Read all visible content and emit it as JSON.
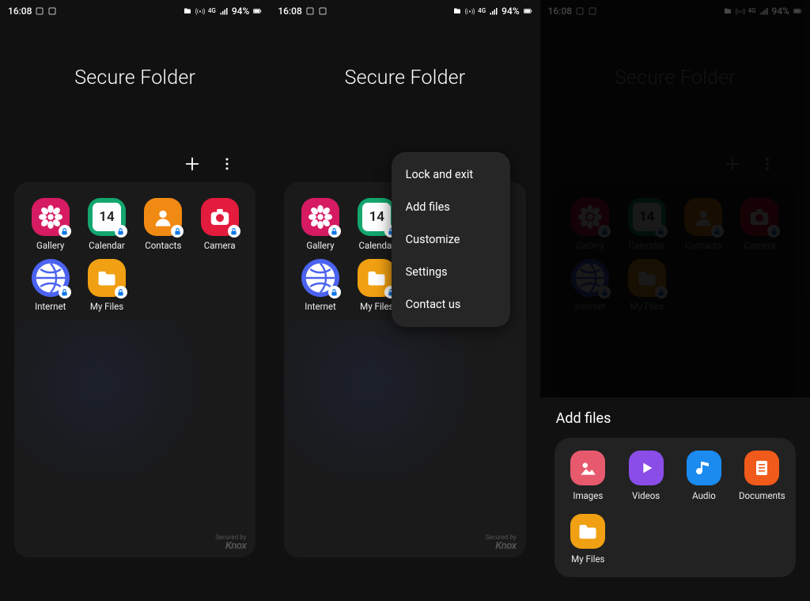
{
  "status": {
    "time": "16:08",
    "battery_pct": "94%",
    "network": "4G",
    "icons": [
      "screenshot-icon",
      "screenshot2-icon",
      "folder-icon",
      "hotspot-icon",
      "4g-icon",
      "signal-icon",
      "battery-icon"
    ]
  },
  "title": "Secure Folder",
  "apps": [
    {
      "name": "Gallery",
      "color": "#d61b63",
      "shape": "square",
      "glyph": "flower"
    },
    {
      "name": "Calendar",
      "color": "#13a66e",
      "shape": "square",
      "glyph": "cal14"
    },
    {
      "name": "Contacts",
      "color": "#f18a13",
      "shape": "square",
      "glyph": "person"
    },
    {
      "name": "Camera",
      "color": "#e31b3d",
      "shape": "square",
      "glyph": "camera"
    },
    {
      "name": "Internet",
      "color": "#4b63f0",
      "shape": "round",
      "glyph": "globe"
    },
    {
      "name": "My Files",
      "color": "#f0a012",
      "shape": "square",
      "glyph": "folder"
    }
  ],
  "calendar_day": "14",
  "knox": {
    "small": "Secured by",
    "big": "Knox"
  },
  "menu": {
    "items": [
      {
        "label": "Lock and exit"
      },
      {
        "label": "Add files"
      },
      {
        "label": "Customize"
      },
      {
        "label": "Settings"
      },
      {
        "label": "Contact us"
      }
    ]
  },
  "sheet": {
    "title": "Add files",
    "items": [
      {
        "label": "Images",
        "color": "#e75a6e",
        "glyph": "image"
      },
      {
        "label": "Videos",
        "color": "#8a4de8",
        "glyph": "play"
      },
      {
        "label": "Audio",
        "color": "#1b8bf0",
        "glyph": "note"
      },
      {
        "label": "Documents",
        "color": "#f05a1b",
        "glyph": "doc"
      },
      {
        "label": "My Files",
        "color": "#f0a012",
        "glyph": "folder"
      }
    ]
  }
}
